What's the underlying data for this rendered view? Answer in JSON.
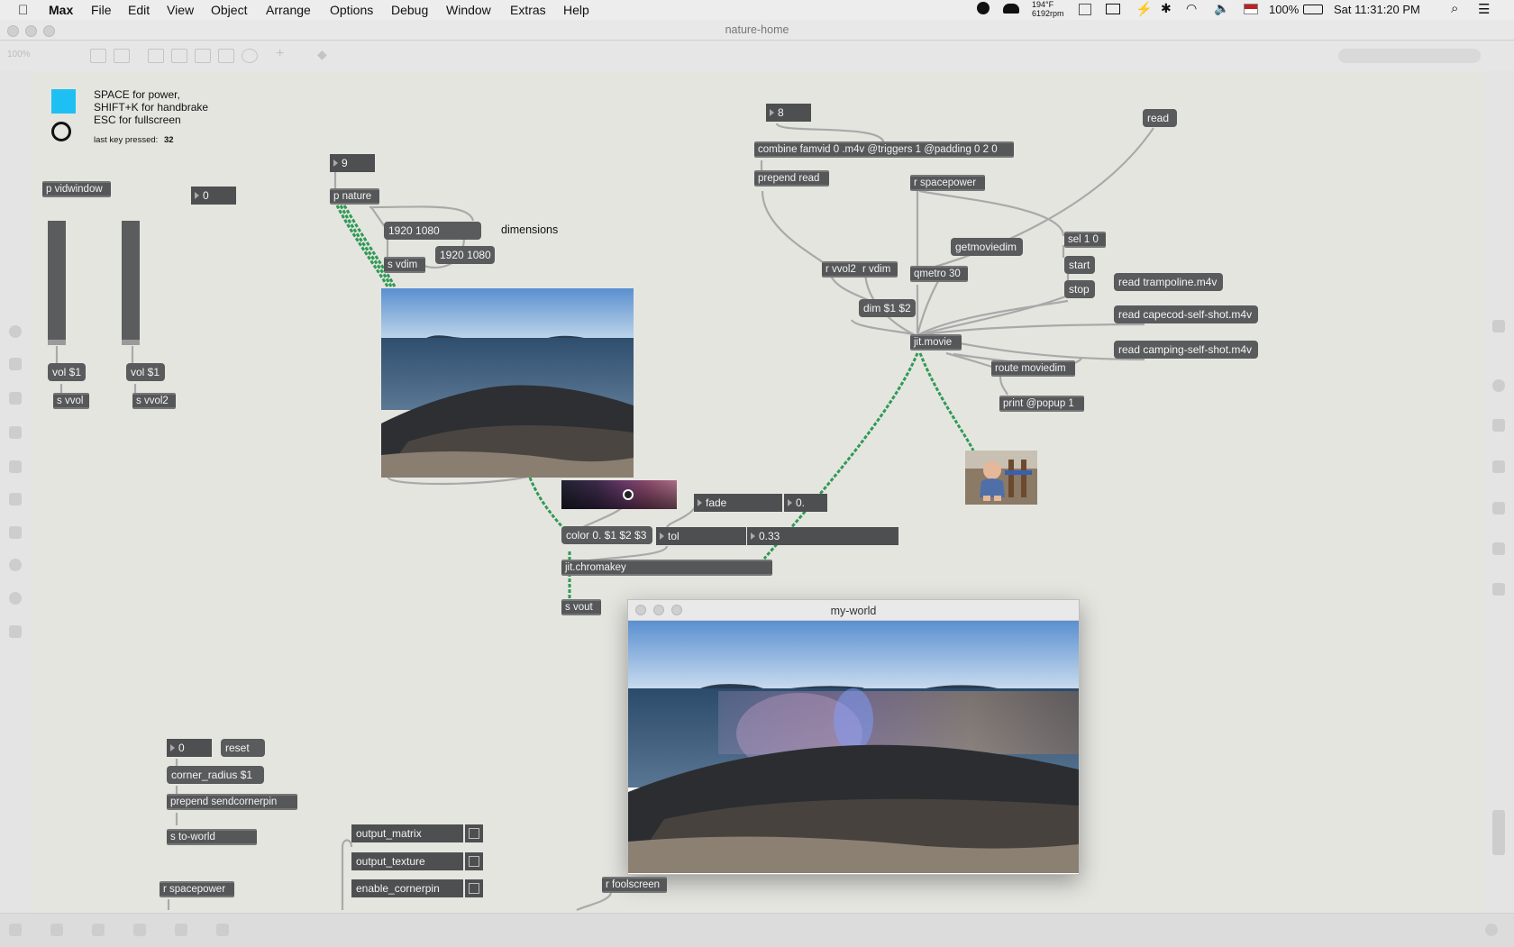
{
  "menubar": {
    "app": "Max",
    "items": [
      "File",
      "Edit",
      "View",
      "Object",
      "Arrange",
      "Options",
      "Debug",
      "Window",
      "Extras",
      "Help"
    ],
    "temp": "194°F",
    "rpm": "6192rpm",
    "battery": "100%",
    "clock": "Sat 11:31:20 PM"
  },
  "window": {
    "title": "nature-home",
    "zoom": "100%"
  },
  "help": {
    "lines": [
      "SPACE for power,",
      "SHIFT+K for handbrake",
      "ESC for fullscreen"
    ],
    "last_key_label": "last key pressed:",
    "last_key_value": "32"
  },
  "colors": {
    "accent_square": "#1ec0f4",
    "cord_video": "#2f9a55"
  },
  "objects": {
    "p_vidwindow": "p vidwindow",
    "num_top_left": "0",
    "vol1": "vol $1",
    "vol2": "vol $1",
    "s_vvol": "s vvol",
    "s_vvol2": "s vvol2",
    "num_9": "9",
    "p_nature": "p nature",
    "dim_msg1": "1920 1080",
    "dim_msg2": "1920 1080",
    "dimensions_label": "dimensions",
    "s_vdim": "s vdim",
    "num_8": "8",
    "combine": "combine famvid 0 .m4v @triggers 1 @padding 0 2 0",
    "prepend_read": "prepend read",
    "read": "read",
    "r_spacepower": "r spacepower",
    "getmoviedim": "getmoviedim",
    "sel": "sel 1 0",
    "start": "start",
    "stop": "stop",
    "r_vvol2": "r vvol2",
    "r_vdim": "r vdim",
    "qmetro": "qmetro 30",
    "read_trampoline": "read trampoline.m4v",
    "dim_msg": "dim $1 $2",
    "read_capecod": "read capecod-self-shot.m4v",
    "jit_movie": "jit.movie",
    "read_camping": "read camping-self-shot.m4v",
    "route_moviedim": "route moviedim",
    "print_popup": "print @popup 1",
    "fade": "fade",
    "fade_value": "0.",
    "color_msg": "color 0. $1 $2 $3",
    "tol": "tol",
    "tol_value": "0.33",
    "jit_chromakey": "jit.chromakey",
    "s_vout": "s vout",
    "num_corner": "0",
    "reset": "reset",
    "corner_radius": "corner_radius $1",
    "prepend_sendcornerpin": "prepend sendcornerpin",
    "s_to_world": "s to-world",
    "r_spacepower_bottom": "r spacepower",
    "output_matrix": "output_matrix",
    "output_texture": "output_texture",
    "enable_cornerpin": "enable_cornerpin",
    "r_foolscreen": "r foolscreen"
  },
  "sliders": [
    {
      "name": "vol-slider-1",
      "value": 0.0
    },
    {
      "name": "vol-slider-2",
      "value": 0.0
    }
  ],
  "toggles": [
    {
      "name": "output_matrix",
      "checked": false
    },
    {
      "name": "output_texture",
      "checked": false
    },
    {
      "name": "enable_cornerpin",
      "checked": false
    }
  ],
  "world_window": {
    "title": "my-world"
  }
}
